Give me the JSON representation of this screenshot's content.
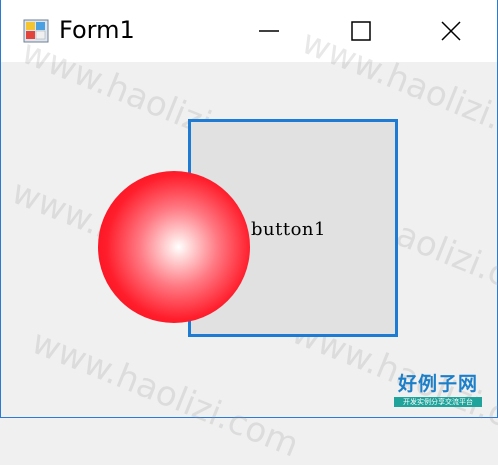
{
  "window": {
    "title": "Form1",
    "icons": {
      "app": "form-app-icon",
      "minimize": "minimize-icon",
      "maximize": "maximize-icon",
      "close": "close-icon"
    },
    "accent_color": "#1e7bd3"
  },
  "form": {
    "button1_label": "button1",
    "ball_color": "#ff1e2c"
  },
  "watermark": {
    "text": "www.haolizi.com"
  },
  "logo": {
    "main": "好例子网",
    "sub": "开发实例分享交流平台"
  }
}
